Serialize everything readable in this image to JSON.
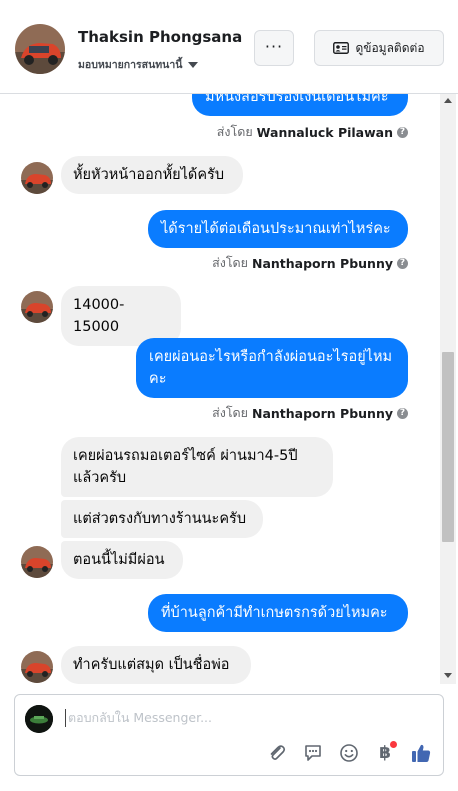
{
  "header": {
    "name": "Thaksin Phongsana",
    "assign_label": "มอบหมายการสนทนานี้",
    "contact_button_label": "ดูข้อมูลติดต่อ",
    "more_button_label": "···"
  },
  "messages": {
    "m0_text": "มีหนังสือรับรองเงินเดือนไม่คะ",
    "m0_sentby_prefix": "ส่งโดย",
    "m0_sentby_name": "Wannaluck Pilawan",
    "m1_text": "หั้ยหัวหน้าออกหั้ยได้ครับ",
    "m2_text": "ได้รายได้ต่อเดือนประมาณเท่าไหร่คะ",
    "m2_sentby_prefix": "ส่งโดย",
    "m2_sentby_name": "Nanthaporn Pbunny",
    "m3_text": "14000-15000",
    "m4_text": "เคยผ่อนอะไรหรือกำลังผ่อนอะไรอยู่ไหมคะ",
    "m4_sentby_prefix": "ส่งโดย",
    "m4_sentby_name": "Nanthaporn Pbunny",
    "m5_text": "เคยผ่อนรถมอเตอร์ไซค์ ผ่านมา4-5ปีแล้วครับ",
    "m6_text": "แต่ส่วตรงกับทางร้านนะครับ",
    "m7_text": "ตอนนี้ไม่มีผ่อน",
    "m8_text": "ที่บ้านลูกค้ามีทำเกษตรกรด้วยไหมคะ",
    "m9_text": "ทำครับแต่สมุด เป็นชื่อพ่อ"
  },
  "composer": {
    "placeholder": "ตอบกลับใน Messenger..."
  },
  "colors": {
    "outgoing_bubble": "#0a7cff",
    "incoming_bubble": "#f0f0f0",
    "like_icon": "#4267b2",
    "notification_dot": "#fa383e"
  },
  "icons": [
    "more-icon",
    "contact-card-icon",
    "chevron-down-icon",
    "help-icon",
    "attachment-icon",
    "chat-bubble-icon",
    "emoji-icon",
    "baht-payment-icon",
    "thumbs-up-icon"
  ]
}
